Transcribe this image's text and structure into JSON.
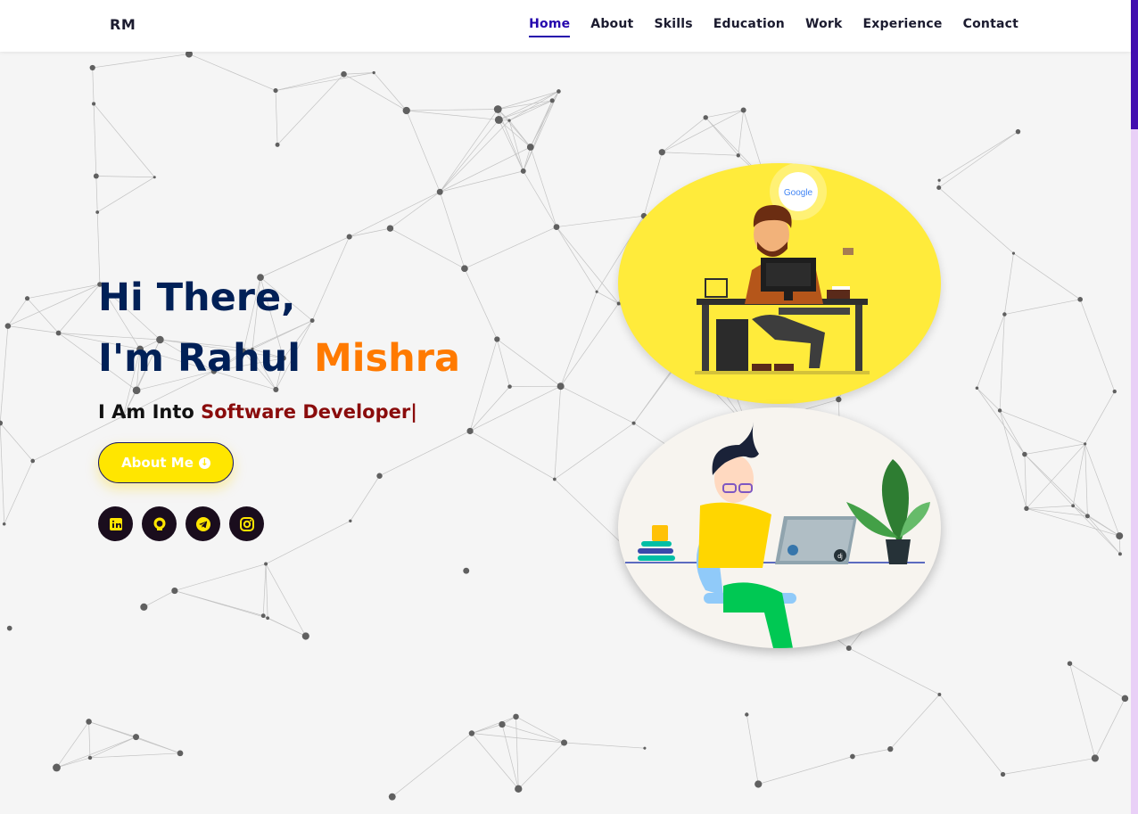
{
  "header": {
    "logo": "RM",
    "nav": [
      "Home",
      "About",
      "Skills",
      "Education",
      "Work",
      "Experience",
      "Contact"
    ],
    "active": "Home"
  },
  "hero": {
    "line1": "Hi There,",
    "line2_prefix": "I'm Rahul ",
    "line2_highlight": "Mishra",
    "role_prefix": "I Am Into ",
    "role_typed": "Software Developer|",
    "button_label": "About Me"
  },
  "socials": [
    {
      "icon": "linkedin-icon"
    },
    {
      "icon": "github-icon"
    },
    {
      "icon": "telegram-icon"
    },
    {
      "icon": "instagram-icon"
    }
  ],
  "illustration1": {
    "badge": "Google"
  },
  "illustration2": {
    "laptop_badge": "dj"
  },
  "colors": {
    "navy": "#002057",
    "orange": "#ff7a00",
    "dark_red": "#8a0c0c",
    "yellow": "#ffe600",
    "active_link": "#2506ad"
  }
}
